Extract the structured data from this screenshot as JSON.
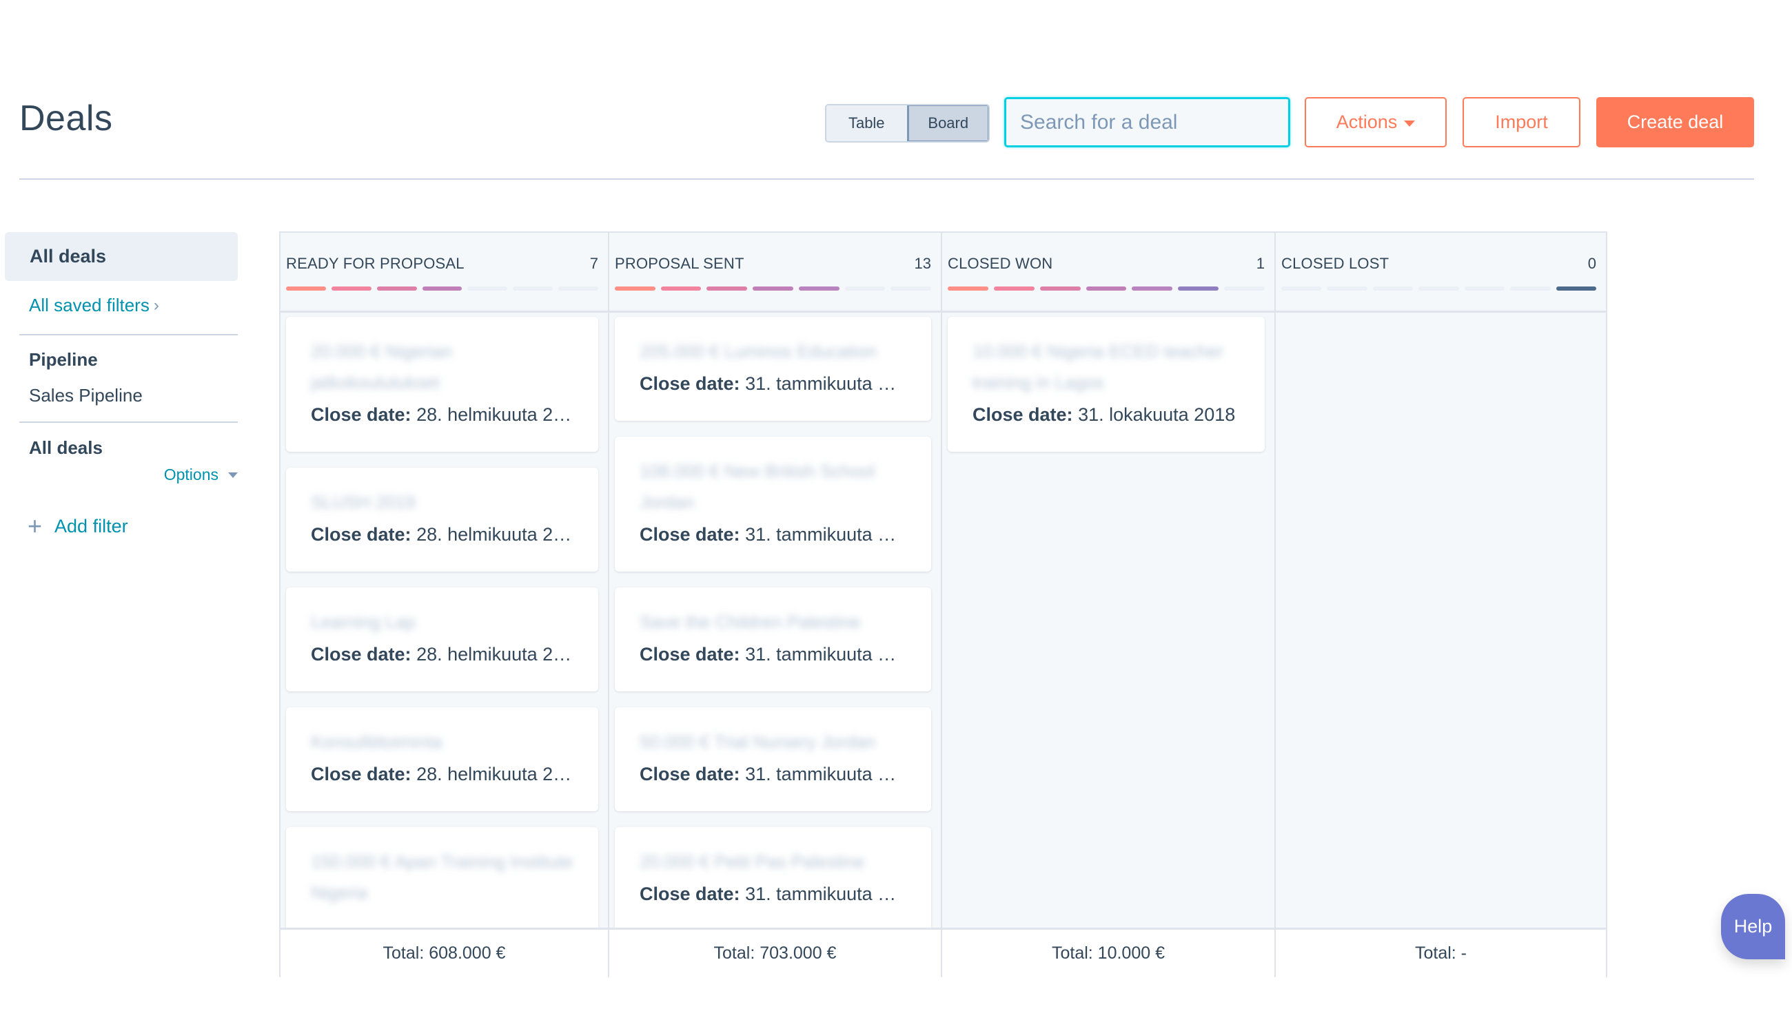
{
  "header": {
    "title": "Deals",
    "view_toggle": {
      "table_label": "Table",
      "board_label": "Board",
      "active": "Board"
    },
    "search": {
      "placeholder": "Search for a deal",
      "value": ""
    },
    "actions_label": "Actions",
    "import_label": "Import",
    "create_label": "Create deal"
  },
  "sidebar": {
    "active_view": "All deals",
    "saved_filters_link": "All saved filters",
    "pipeline_heading": "Pipeline",
    "pipeline_value": "Sales Pipeline",
    "filter_heading": "All deals",
    "options_label": "Options",
    "add_filter_label": "Add filter"
  },
  "colors": {
    "accent": "#ff7a59",
    "link": "#0091ae",
    "search_focus": "#00d0e4",
    "help": "#6a78d1",
    "stage_colors": [
      "#ff8f87",
      "#f2849e",
      "#de7fa8",
      "#c17fba",
      "#b983bf",
      "#8f7fc0",
      "#4b6a8c"
    ]
  },
  "board": {
    "close_date_label": "Close date:",
    "columns": [
      {
        "title": "READY FOR PROPOSAL",
        "count": "7",
        "stage_filled": 4,
        "stage_total": 7,
        "total": "Total: 608.000 €",
        "cards": [
          {
            "name": "20.000 € Nigerian jatkokoulutukset",
            "close_date": "28. helmikuuta 2…"
          },
          {
            "name": "SLUSH 2019",
            "close_date": "28. helmikuuta 2…"
          },
          {
            "name": "Learning Lap",
            "close_date": "28. helmikuuta 2…"
          },
          {
            "name": "Konsulttitoiminta",
            "close_date": "28. helmikuuta 2…"
          },
          {
            "name": "150.000 € Apan Training Institute Nigeria",
            "close_date": ""
          }
        ]
      },
      {
        "title": "PROPOSAL SENT",
        "count": "13",
        "stage_filled": 5,
        "stage_total": 7,
        "total": "Total: 703.000 €",
        "cards": [
          {
            "name": "205.000 € Luminos Education",
            "close_date": "31. tammikuuta 2…"
          },
          {
            "name": "108.000 € New British School Jordan",
            "close_date": "31. tammikuuta 2…"
          },
          {
            "name": "Save the Children Palestine",
            "close_date": "31. tammikuuta 2…"
          },
          {
            "name": "50.000 € Trial Nursery Jordan",
            "close_date": "31. tammikuuta 2…"
          },
          {
            "name": "20.000 € Petit Pas Palestine",
            "close_date": "31. tammikuuta 2…"
          }
        ]
      },
      {
        "title": "CLOSED WON",
        "count": "1",
        "stage_filled": 6,
        "stage_total": 7,
        "total": "Total: 10.000 €",
        "cards": [
          {
            "name": "10.000 € Nigeria ECED teacher training in Lagos",
            "close_date": "31. lokakuuta 2018"
          }
        ]
      },
      {
        "title": "CLOSED LOST",
        "count": "0",
        "stage_filled": 0,
        "stage_total": 7,
        "lost_marker": true,
        "total": "Total: -",
        "cards": []
      }
    ]
  },
  "help_label": "Help"
}
